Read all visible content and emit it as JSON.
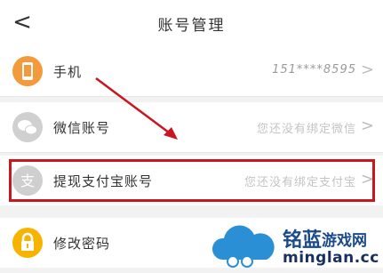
{
  "header": {
    "title": "账号管理",
    "back_glyph": "<"
  },
  "rows": [
    {
      "label": "手机",
      "value": "151****8595",
      "icon": "phone-icon",
      "color": "#f39a3c"
    },
    {
      "label": "微信账号",
      "value": "您还没有绑定微信",
      "icon": "wechat-icon",
      "color": "#d0d0d0"
    },
    {
      "label": "提现支付宝账号",
      "value": "您还没有绑定支付宝",
      "icon": "alipay-icon",
      "color": "#cfcfcf"
    },
    {
      "label": "修改密码",
      "value": "",
      "icon": "lock-icon",
      "color": "#f6b300"
    }
  ],
  "chevron": ">",
  "annotation": {
    "highlight_color": "#c9161f"
  },
  "watermark": {
    "brand_cn": "铭蓝",
    "game_cn": "游戏网",
    "domain": "minglan.cc"
  }
}
